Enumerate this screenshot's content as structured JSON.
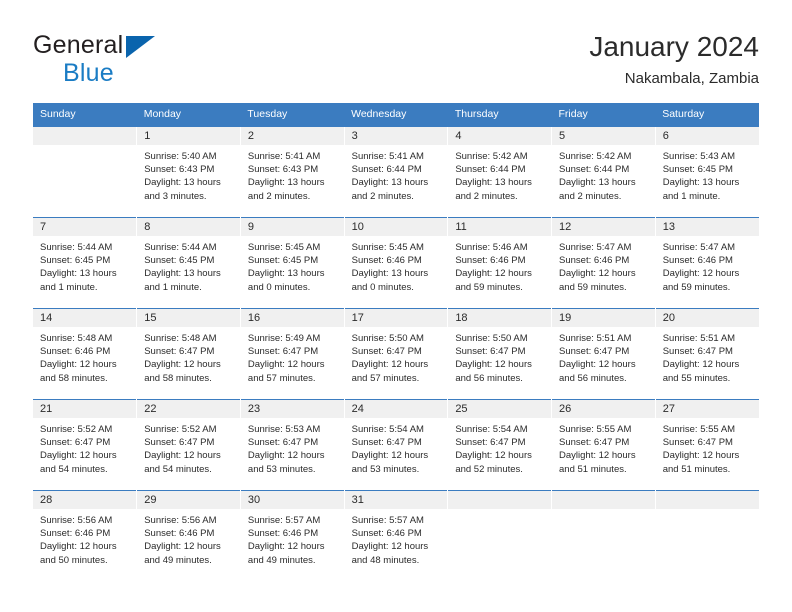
{
  "brand": {
    "name_top": "General",
    "name_bottom": "Blue",
    "triangle_color": "#0a64ad",
    "blue_color": "#1a7cc4"
  },
  "header": {
    "title": "January 2024",
    "subtitle": "Nakambala, Zambia"
  },
  "theme": {
    "header_bg": "#3b7cc0",
    "daynum_band_bg": "#f0f0f0",
    "text_color": "#2b2b2b"
  },
  "weekdays": [
    "Sunday",
    "Monday",
    "Tuesday",
    "Wednesday",
    "Thursday",
    "Friday",
    "Saturday"
  ],
  "weeks": [
    [
      {
        "day": "",
        "sunrise": "",
        "sunset": "",
        "daylight": ""
      },
      {
        "day": "1",
        "sunrise": "Sunrise: 5:40 AM",
        "sunset": "Sunset: 6:43 PM",
        "daylight": "Daylight: 13 hours and 3 minutes."
      },
      {
        "day": "2",
        "sunrise": "Sunrise: 5:41 AM",
        "sunset": "Sunset: 6:43 PM",
        "daylight": "Daylight: 13 hours and 2 minutes."
      },
      {
        "day": "3",
        "sunrise": "Sunrise: 5:41 AM",
        "sunset": "Sunset: 6:44 PM",
        "daylight": "Daylight: 13 hours and 2 minutes."
      },
      {
        "day": "4",
        "sunrise": "Sunrise: 5:42 AM",
        "sunset": "Sunset: 6:44 PM",
        "daylight": "Daylight: 13 hours and 2 minutes."
      },
      {
        "day": "5",
        "sunrise": "Sunrise: 5:42 AM",
        "sunset": "Sunset: 6:44 PM",
        "daylight": "Daylight: 13 hours and 2 minutes."
      },
      {
        "day": "6",
        "sunrise": "Sunrise: 5:43 AM",
        "sunset": "Sunset: 6:45 PM",
        "daylight": "Daylight: 13 hours and 1 minute."
      }
    ],
    [
      {
        "day": "7",
        "sunrise": "Sunrise: 5:44 AM",
        "sunset": "Sunset: 6:45 PM",
        "daylight": "Daylight: 13 hours and 1 minute."
      },
      {
        "day": "8",
        "sunrise": "Sunrise: 5:44 AM",
        "sunset": "Sunset: 6:45 PM",
        "daylight": "Daylight: 13 hours and 1 minute."
      },
      {
        "day": "9",
        "sunrise": "Sunrise: 5:45 AM",
        "sunset": "Sunset: 6:45 PM",
        "daylight": "Daylight: 13 hours and 0 minutes."
      },
      {
        "day": "10",
        "sunrise": "Sunrise: 5:45 AM",
        "sunset": "Sunset: 6:46 PM",
        "daylight": "Daylight: 13 hours and 0 minutes."
      },
      {
        "day": "11",
        "sunrise": "Sunrise: 5:46 AM",
        "sunset": "Sunset: 6:46 PM",
        "daylight": "Daylight: 12 hours and 59 minutes."
      },
      {
        "day": "12",
        "sunrise": "Sunrise: 5:47 AM",
        "sunset": "Sunset: 6:46 PM",
        "daylight": "Daylight: 12 hours and 59 minutes."
      },
      {
        "day": "13",
        "sunrise": "Sunrise: 5:47 AM",
        "sunset": "Sunset: 6:46 PM",
        "daylight": "Daylight: 12 hours and 59 minutes."
      }
    ],
    [
      {
        "day": "14",
        "sunrise": "Sunrise: 5:48 AM",
        "sunset": "Sunset: 6:46 PM",
        "daylight": "Daylight: 12 hours and 58 minutes."
      },
      {
        "day": "15",
        "sunrise": "Sunrise: 5:48 AM",
        "sunset": "Sunset: 6:47 PM",
        "daylight": "Daylight: 12 hours and 58 minutes."
      },
      {
        "day": "16",
        "sunrise": "Sunrise: 5:49 AM",
        "sunset": "Sunset: 6:47 PM",
        "daylight": "Daylight: 12 hours and 57 minutes."
      },
      {
        "day": "17",
        "sunrise": "Sunrise: 5:50 AM",
        "sunset": "Sunset: 6:47 PM",
        "daylight": "Daylight: 12 hours and 57 minutes."
      },
      {
        "day": "18",
        "sunrise": "Sunrise: 5:50 AM",
        "sunset": "Sunset: 6:47 PM",
        "daylight": "Daylight: 12 hours and 56 minutes."
      },
      {
        "day": "19",
        "sunrise": "Sunrise: 5:51 AM",
        "sunset": "Sunset: 6:47 PM",
        "daylight": "Daylight: 12 hours and 56 minutes."
      },
      {
        "day": "20",
        "sunrise": "Sunrise: 5:51 AM",
        "sunset": "Sunset: 6:47 PM",
        "daylight": "Daylight: 12 hours and 55 minutes."
      }
    ],
    [
      {
        "day": "21",
        "sunrise": "Sunrise: 5:52 AM",
        "sunset": "Sunset: 6:47 PM",
        "daylight": "Daylight: 12 hours and 54 minutes."
      },
      {
        "day": "22",
        "sunrise": "Sunrise: 5:52 AM",
        "sunset": "Sunset: 6:47 PM",
        "daylight": "Daylight: 12 hours and 54 minutes."
      },
      {
        "day": "23",
        "sunrise": "Sunrise: 5:53 AM",
        "sunset": "Sunset: 6:47 PM",
        "daylight": "Daylight: 12 hours and 53 minutes."
      },
      {
        "day": "24",
        "sunrise": "Sunrise: 5:54 AM",
        "sunset": "Sunset: 6:47 PM",
        "daylight": "Daylight: 12 hours and 53 minutes."
      },
      {
        "day": "25",
        "sunrise": "Sunrise: 5:54 AM",
        "sunset": "Sunset: 6:47 PM",
        "daylight": "Daylight: 12 hours and 52 minutes."
      },
      {
        "day": "26",
        "sunrise": "Sunrise: 5:55 AM",
        "sunset": "Sunset: 6:47 PM",
        "daylight": "Daylight: 12 hours and 51 minutes."
      },
      {
        "day": "27",
        "sunrise": "Sunrise: 5:55 AM",
        "sunset": "Sunset: 6:47 PM",
        "daylight": "Daylight: 12 hours and 51 minutes."
      }
    ],
    [
      {
        "day": "28",
        "sunrise": "Sunrise: 5:56 AM",
        "sunset": "Sunset: 6:46 PM",
        "daylight": "Daylight: 12 hours and 50 minutes."
      },
      {
        "day": "29",
        "sunrise": "Sunrise: 5:56 AM",
        "sunset": "Sunset: 6:46 PM",
        "daylight": "Daylight: 12 hours and 49 minutes."
      },
      {
        "day": "30",
        "sunrise": "Sunrise: 5:57 AM",
        "sunset": "Sunset: 6:46 PM",
        "daylight": "Daylight: 12 hours and 49 minutes."
      },
      {
        "day": "31",
        "sunrise": "Sunrise: 5:57 AM",
        "sunset": "Sunset: 6:46 PM",
        "daylight": "Daylight: 12 hours and 48 minutes."
      },
      {
        "day": "",
        "sunrise": "",
        "sunset": "",
        "daylight": ""
      },
      {
        "day": "",
        "sunrise": "",
        "sunset": "",
        "daylight": ""
      },
      {
        "day": "",
        "sunrise": "",
        "sunset": "",
        "daylight": ""
      }
    ]
  ]
}
